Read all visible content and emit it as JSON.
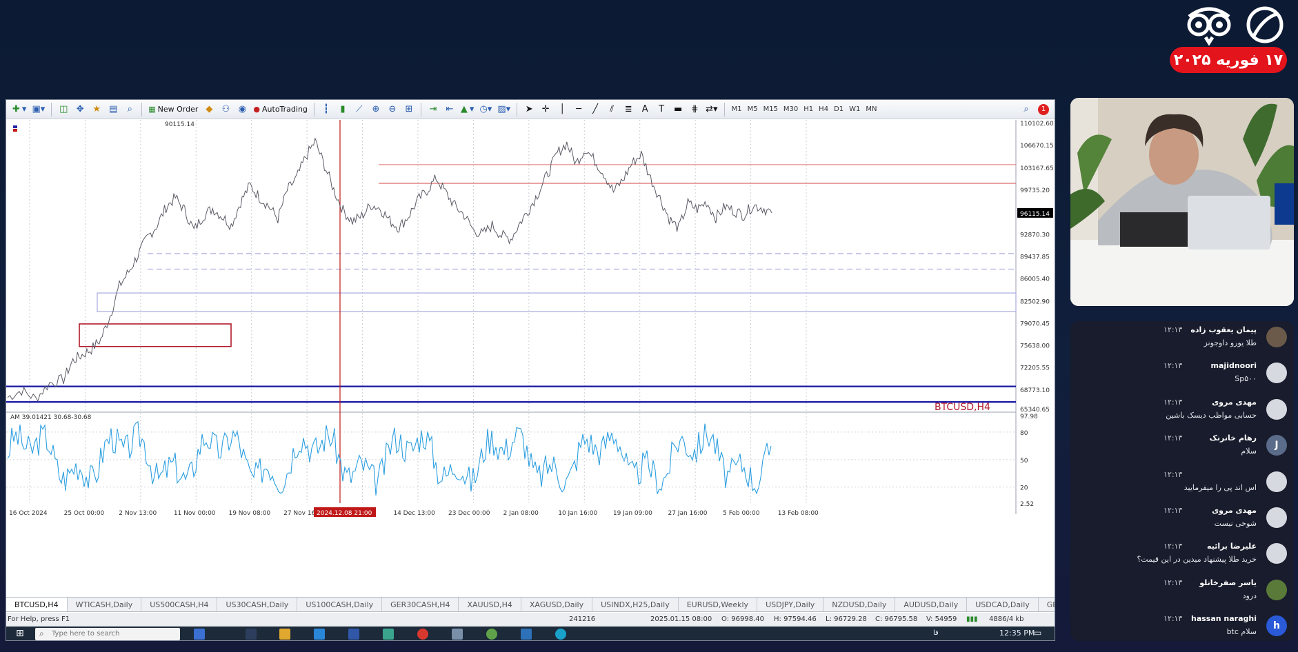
{
  "branding": {
    "date_label": "۱۷ فوریه ۲۰۲۵",
    "accent_color": "#e3141c"
  },
  "toolbar": {
    "new_order_label": "New Order",
    "autotrading_label": "AutoTrading",
    "timeframes": [
      "M1",
      "M5",
      "M15",
      "M30",
      "H1",
      "H4",
      "D1",
      "W1",
      "MN"
    ],
    "alert_count": "1"
  },
  "chart": {
    "info_line": "90115.14",
    "watermark": "BTCUSD,H4",
    "indicator_label": "AM 39.01421 30.68-30.68",
    "marker_date": "2024.12.08 21:00",
    "current_price_label": "96115.14"
  },
  "chart_data": {
    "type": "line",
    "symbol": "BTCUSD",
    "timeframe": "H4",
    "ylim": [
      65540.65,
      110102.6
    ],
    "y_ticks": [
      "110102.60",
      "106670.15",
      "103167.65",
      "99735.20",
      "96115.14",
      "92870.30",
      "89437.85",
      "86005.40",
      "82502.90",
      "79070.45",
      "75638.00",
      "72205.55",
      "68773.10",
      "65340.65"
    ],
    "x_ticks": [
      "16 Oct 2024",
      "25 Oct 00:00",
      "2 Nov 13:00",
      "11 Nov 00:00",
      "19 Nov 08:00",
      "27 Nov 16:00",
      "2024.12.08 21:00",
      "14 Dec 13:00",
      "23 Dec 00:00",
      "2 Jan 08:00",
      "10 Jan 16:00",
      "19 Jan 09:00",
      "27 Jan 16:00",
      "5 Feb 00:00",
      "13 Feb 08:00"
    ],
    "price_path": [
      [
        0,
        67500
      ],
      [
        3,
        68600
      ],
      [
        6,
        67300
      ],
      [
        9,
        69700
      ],
      [
        12,
        70300
      ],
      [
        14,
        73200
      ],
      [
        16,
        74100
      ],
      [
        18,
        75000
      ],
      [
        20,
        76500
      ],
      [
        22,
        80200
      ],
      [
        24,
        84800
      ],
      [
        26,
        87000
      ],
      [
        28,
        89600
      ],
      [
        30,
        92300
      ],
      [
        32,
        94100
      ],
      [
        34,
        97000
      ],
      [
        36,
        98500
      ],
      [
        38,
        96500
      ],
      [
        40,
        93400
      ],
      [
        42,
        95700
      ],
      [
        44,
        96800
      ],
      [
        46,
        95600
      ],
      [
        48,
        94200
      ],
      [
        50,
        97800
      ],
      [
        52,
        100400
      ],
      [
        54,
        98600
      ],
      [
        56,
        97200
      ],
      [
        58,
        95200
      ],
      [
        60,
        99600
      ],
      [
        62,
        101500
      ],
      [
        64,
        104800
      ],
      [
        66,
        107200
      ],
      [
        68,
        103500
      ],
      [
        70,
        99700
      ],
      [
        72,
        96500
      ],
      [
        74,
        94800
      ],
      [
        76,
        95600
      ],
      [
        78,
        97400
      ],
      [
        80,
        96800
      ],
      [
        82,
        94900
      ],
      [
        84,
        93800
      ],
      [
        86,
        95600
      ],
      [
        88,
        98000
      ],
      [
        90,
        99600
      ],
      [
        92,
        101500
      ],
      [
        94,
        99300
      ],
      [
        96,
        97200
      ],
      [
        98,
        95800
      ],
      [
        100,
        93400
      ],
      [
        102,
        92800
      ],
      [
        104,
        94200
      ],
      [
        106,
        92600
      ],
      [
        108,
        92100
      ],
      [
        110,
        94600
      ],
      [
        112,
        96800
      ],
      [
        114,
        99400
      ],
      [
        116,
        102300
      ],
      [
        118,
        105400
      ],
      [
        120,
        106900
      ],
      [
        122,
        103800
      ],
      [
        124,
        106100
      ],
      [
        126,
        104200
      ],
      [
        128,
        102200
      ],
      [
        130,
        99400
      ],
      [
        132,
        101200
      ],
      [
        134,
        103800
      ],
      [
        136,
        105200
      ],
      [
        138,
        101500
      ],
      [
        140,
        98400
      ],
      [
        142,
        95200
      ],
      [
        144,
        93700
      ],
      [
        146,
        97600
      ],
      [
        148,
        96700
      ],
      [
        150,
        97800
      ],
      [
        152,
        95400
      ],
      [
        154,
        97100
      ],
      [
        156,
        96400
      ],
      [
        158,
        95800
      ],
      [
        160,
        97300
      ],
      [
        162,
        96900
      ],
      [
        164,
        96115
      ]
    ],
    "indicator_ylim": [
      2.52,
      97.98
    ],
    "indicator_ticks": [
      "97.98",
      "80",
      "50",
      "20",
      "2.52"
    ]
  },
  "symbol_tabs": [
    "BTCUSD,H4",
    "WTICASH,Daily",
    "US500CASH,H4",
    "US30CASH,Daily",
    "US100CASH,Daily",
    "GER30CASH,H4",
    "XAUUSD,H4",
    "XAGUSD,Daily",
    "USINDX,H25,Daily",
    "EURUSD,Weekly",
    "USDJPY,Daily",
    "NZDUSD,Daily",
    "AUDUSD,Daily",
    "USDCAD,Daily",
    "GBPUSD,W"
  ],
  "status_bar": {
    "help": "For Help, press F1",
    "count": "241216",
    "datetime": "2025.01.15 08:00",
    "open": "O: 96998.40",
    "high": "H: 97594.46",
    "low": "L: 96729.28",
    "close": "C: 96795.58",
    "volume": "V: 54959",
    "traffic": "4886/4 kb"
  },
  "taskbar": {
    "search_placeholder": "Type here to search",
    "clock": "12:35 PM"
  },
  "chat": {
    "messages": [
      {
        "name": "پیمان یعقوب زاده",
        "time": "۱۲:۱۳",
        "text": "طلا یورو داوجونز",
        "avatar": ""
      },
      {
        "name": "majidnoori",
        "time": "۱۲:۱۳",
        "text": "Sp۵۰۰",
        "avatar": ""
      },
      {
        "name": "مهدی مروی",
        "time": "۱۲:۱۳",
        "text": "حسابی مواظب دیسک باشین",
        "avatar": ""
      },
      {
        "name": "رهام خانرنک",
        "time": "۱۲:۱۳",
        "text": "سلام",
        "avatar": "J"
      },
      {
        "name": "",
        "time": "۱۲:۱۳",
        "text": "اس اند پی را میفرمایید",
        "avatar": ""
      },
      {
        "name": "مهدی مروی",
        "time": "۱۲:۱۳",
        "text": "شوخی نیست",
        "avatar": ""
      },
      {
        "name": "علیرضا برائیه",
        "time": "۱۲:۱۳",
        "text": "خرید طلا پیشنهاد میدین در این قیمت؟",
        "avatar": ""
      },
      {
        "name": "یاسر صفرخانلو",
        "time": "۱۲:۱۳",
        "text": "درود",
        "avatar": ""
      },
      {
        "name": "hassan naraghi",
        "time": "۱۲:۱۳",
        "text": "سلام btc",
        "avatar": "h"
      }
    ]
  }
}
